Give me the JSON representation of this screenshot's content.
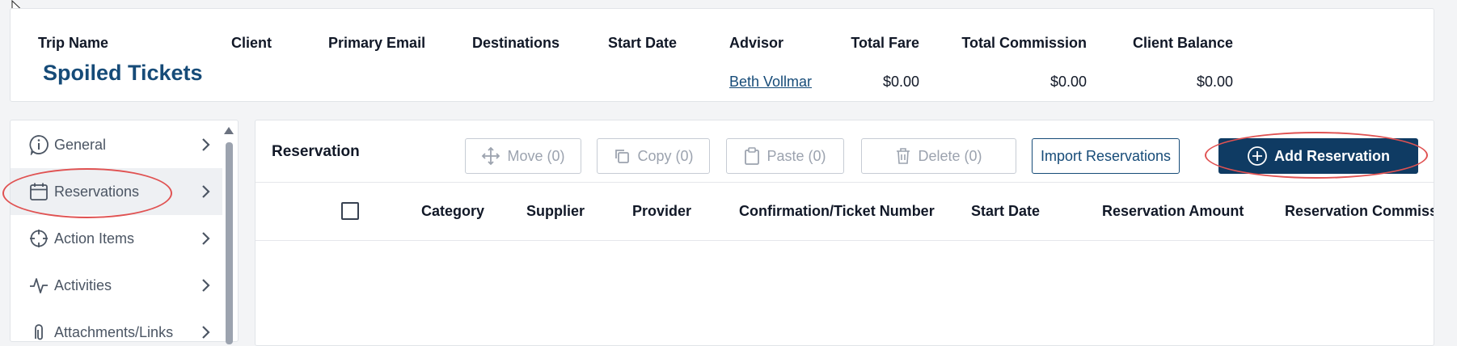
{
  "trip": {
    "columns": {
      "trip_name": "Trip Name",
      "client": "Client",
      "primary_email": "Primary Email",
      "destinations": "Destinations",
      "start_date": "Start Date",
      "advisor": "Advisor",
      "total_fare": "Total Fare",
      "total_commission": "Total Commission",
      "client_balance": "Client Balance"
    },
    "values": {
      "trip_name": "Spoiled Tickets",
      "advisor": "Beth Vollmar",
      "total_fare": "$0.00",
      "total_commission": "$0.00",
      "client_balance": "$0.00"
    }
  },
  "sidebar": {
    "items": [
      {
        "label": "General",
        "icon": "info-circle-icon"
      },
      {
        "label": "Reservations",
        "icon": "calendar-icon",
        "active": true
      },
      {
        "label": "Action Items",
        "icon": "crosshair-icon"
      },
      {
        "label": "Activities",
        "icon": "activity-icon"
      },
      {
        "label": "Attachments/Links",
        "icon": "paperclip-icon"
      }
    ]
  },
  "reservation": {
    "title": "Reservation",
    "buttons": {
      "move": "Move (0)",
      "copy": "Copy (0)",
      "paste": "Paste (0)",
      "delete": "Delete (0)",
      "import": "Import Reservations",
      "add": "Add Reservation"
    },
    "columns": [
      "Category",
      "Supplier",
      "Provider",
      "Confirmation/Ticket Number",
      "Start Date",
      "Reservation Amount",
      "Reservation Commissio"
    ]
  },
  "colors": {
    "primary": "#0f3b63",
    "link": "#164b78",
    "annotation": "#e05252"
  }
}
